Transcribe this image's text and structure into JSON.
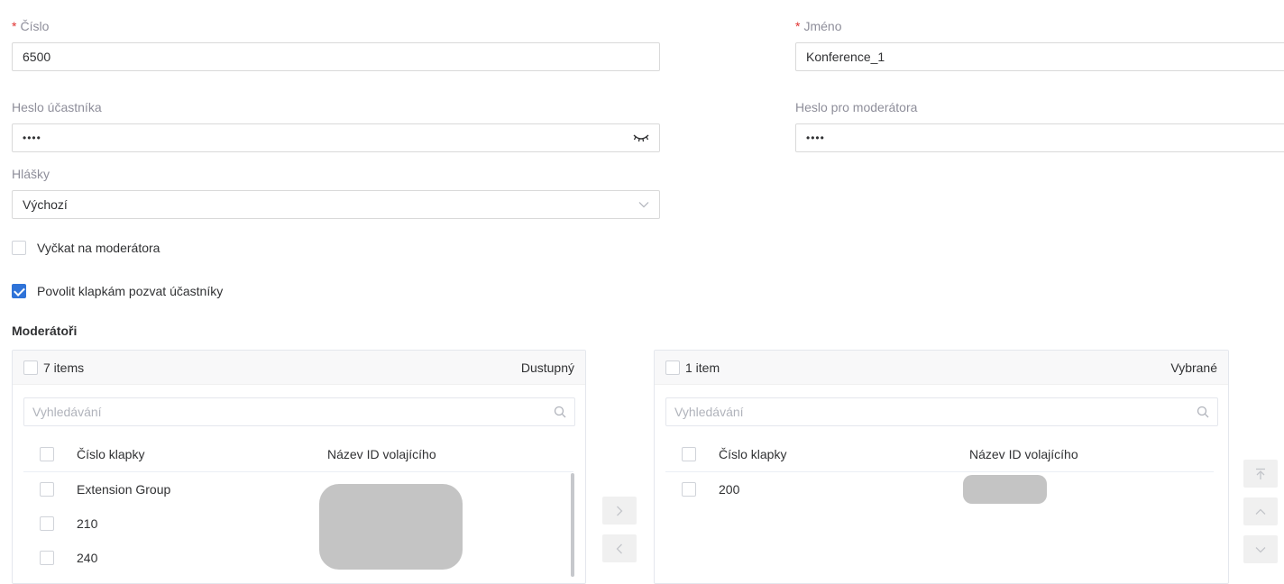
{
  "form": {
    "number": {
      "label": "Číslo",
      "required_mark": "*",
      "value": "6500"
    },
    "name": {
      "label": "Jméno",
      "required_mark": "*",
      "value": "Konference_1"
    },
    "participant_password": {
      "label": "Heslo účastníka",
      "value": "••••"
    },
    "moderator_password": {
      "label": "Heslo pro moderátora",
      "value": "••••"
    },
    "prompts": {
      "label": "Hlášky",
      "value": "Výchozí"
    },
    "wait_for_moderator": {
      "label": "Vyčkat na moderátora",
      "checked": false
    },
    "allow_invite": {
      "label": "Povolit klapkám pozvat účastníky",
      "checked": true
    }
  },
  "moderators": {
    "title": "Moderátoři",
    "available": {
      "count_label": "7 items",
      "title": "Dustupný",
      "search_placeholder": "Vyhledávání",
      "columns": [
        "Číslo klapky",
        "Název ID volajícího"
      ],
      "rows": [
        {
          "ext": "Extension Group"
        },
        {
          "ext": "210"
        },
        {
          "ext": "240"
        }
      ]
    },
    "selected": {
      "count_label": "1 item",
      "title": "Vybrané",
      "search_placeholder": "Vyhledávání",
      "columns": [
        "Číslo klapky",
        "Název ID volajícího"
      ],
      "rows": [
        {
          "ext": "200"
        }
      ]
    }
  },
  "icons": {
    "password_toggle": "eye-closed-icon",
    "dropdown": "chevron-down-icon",
    "search": "search-icon",
    "move_right": "chevron-right-icon",
    "move_left": "chevron-left-icon",
    "move_top": "arrow-to-top-icon",
    "move_up": "chevron-up-icon",
    "move_down": "chevron-down-icon"
  },
  "colors": {
    "accent": "#2f73d8",
    "required": "#e0312f",
    "label": "#8e8e9a",
    "border": "#d9d9d9"
  }
}
